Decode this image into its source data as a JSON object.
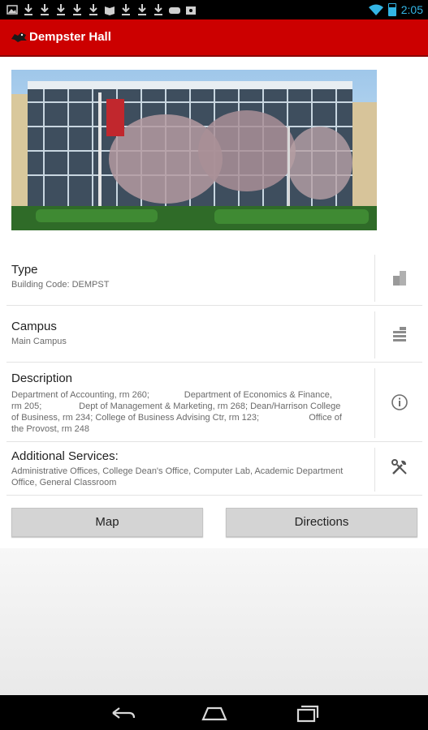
{
  "status_bar": {
    "time": "2:05",
    "notification_icons": [
      "image-icon",
      "download-icon",
      "download-icon",
      "download-icon",
      "download-icon",
      "download-icon",
      "book-icon",
      "download-icon",
      "download-icon",
      "download-icon",
      "gamepad-icon",
      "bag-icon"
    ]
  },
  "action_bar": {
    "title": "Dempster Hall",
    "color": "#cc0000"
  },
  "building": {
    "photo_alt": "building photo",
    "rows": [
      {
        "title": "Type",
        "body": "Building Code: DEMPST",
        "icon": "building-type-icon"
      },
      {
        "title": "Campus",
        "body": "Main Campus",
        "icon": "campus-icon"
      },
      {
        "title": "Description",
        "body": "Department of Accounting, rm 260;              Department of Economics & Finance, rm 205;               Dept of Management & Marketing, rm 268; Dean/Harrison College of Business, rm 234; College of Business Advising Ctr, rm 123;                    Office of the Provost, rm 248",
        "icon": "info-icon"
      },
      {
        "title": "Additional Services:",
        "body": "Administrative Offices, College Dean's Office, Computer Lab, Academic Department Office, General Classroom",
        "icon": "tools-icon"
      }
    ]
  },
  "buttons": {
    "map_label": "Map",
    "directions_label": "Directions"
  },
  "nav": {
    "back_icon": "back-icon",
    "home_icon": "home-icon",
    "recents_icon": "recents-icon"
  }
}
